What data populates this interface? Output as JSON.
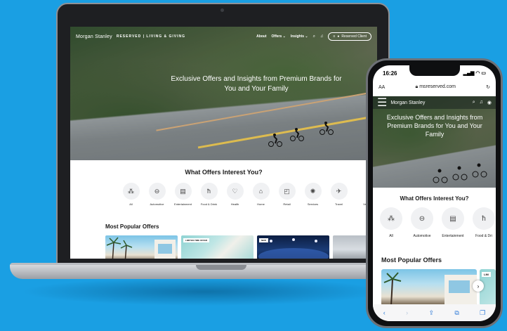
{
  "laptop": {
    "nav": {
      "brand": "Morgan Stanley",
      "subbrand": "RESERVED | LIVING & GIVING",
      "links": [
        "About",
        "Offers ⌄",
        "Insights ⌄"
      ],
      "client_button": "Reserved Client"
    },
    "hero_title": "Exclusive Offers and Insights from Premium Brands for You and Your Family",
    "offers_title": "What Offers Interest You?",
    "categories": [
      "All",
      "Automotive",
      "Entertainment",
      "Food & Drink",
      "Health",
      "Home",
      "Retail",
      "Services",
      "Travel",
      "Ve"
    ],
    "category_icons": [
      "grid-icon",
      "car-icon",
      "theater-icon",
      "dining-icon",
      "stethoscope-icon",
      "home-icon",
      "shopping-bag-icon",
      "services-icon",
      "plane-icon"
    ],
    "popular_title": "Most Popular Offers",
    "card_badges": [
      "LIMITED-TIME OFFER",
      "NEW"
    ]
  },
  "phone": {
    "time": "16:26",
    "text_size": "AA",
    "url": "msreserved.com",
    "brand": "Morgan Stanley",
    "hero_title": "Exclusive Offers and Insights from Premium Brands for You and Your Family",
    "offers_title": "What Offers Interest You?",
    "categories": [
      "All",
      "Automotive",
      "Entertainment",
      "Food & Dri"
    ],
    "popular_title": "Most Popular Offers",
    "card_badge": "LIM"
  }
}
